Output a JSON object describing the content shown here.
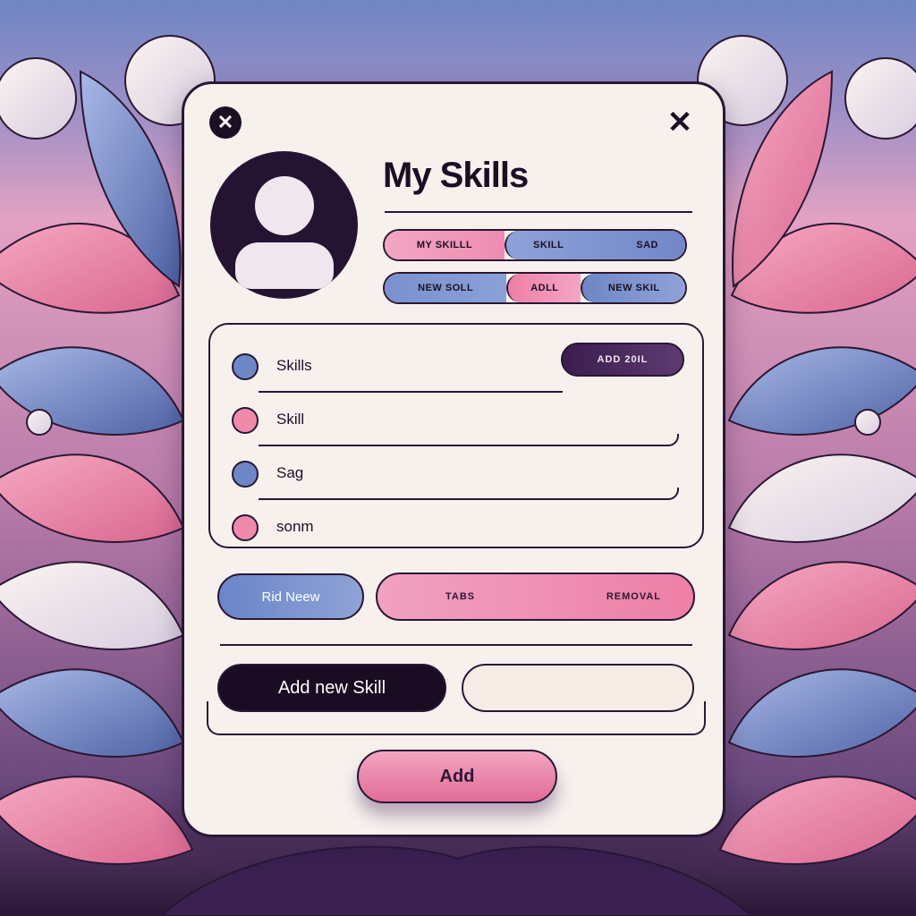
{
  "dialog": {
    "title": "My Skills",
    "close_left_glyph": "✕",
    "close_right_glyph": "✕"
  },
  "tab_row_1": [
    "MY SKILLL",
    "SKILL",
    "SAD"
  ],
  "tab_row_2": [
    "NEW SOLL",
    "ADLL",
    "NEW SKIL"
  ],
  "skills_list": {
    "add_button_label": "ADD 20IL",
    "items": [
      {
        "label": "Skills",
        "color": "#6d87c6"
      },
      {
        "label": "Skill",
        "color": "#ef8aaa"
      },
      {
        "label": "Sag",
        "color": "#6d87c6"
      },
      {
        "label": "sonm",
        "color": "#ef8aaa"
      }
    ]
  },
  "actions": {
    "find_label": "Rid Neew",
    "tabs_label": "TABS",
    "removal_label": "REMOVAL"
  },
  "new_skill": {
    "button_label": "Add new Skill",
    "input_value": "",
    "input_placeholder": ""
  },
  "submit": {
    "label": "Add"
  },
  "colors": {
    "accent_pink": "#ef8aaa",
    "accent_blue": "#6d87c6",
    "dark": "#1b0f24",
    "card_bg": "#f7f1ee"
  }
}
